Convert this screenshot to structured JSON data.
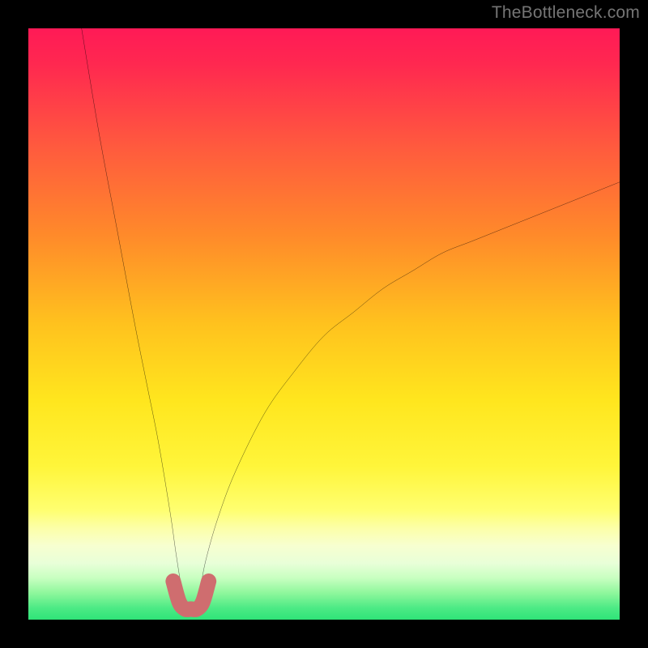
{
  "watermark": "TheBottleneck.com",
  "colors": {
    "black": "#000000",
    "curve": "#000000",
    "flat_region": "#cf6d6f",
    "bottom_green": "#2fe478"
  },
  "chart_data": {
    "type": "line",
    "title": "",
    "xlabel": "",
    "ylabel": "",
    "xlim": [
      0,
      100
    ],
    "ylim": [
      0,
      100
    ],
    "note": "V-shaped bottleneck curve on a vertical heat gradient. x normalized 0–100, y normalized 0–100 (0 = bottom/green, 100 = top/red). Minimum near x≈27. Left branch approaches y≈100 at x≈9; right branch rises to y≈74 at x=100.",
    "series": [
      {
        "name": "bottleneck-curve",
        "x": [
          9,
          12,
          15,
          18,
          20,
          22,
          24,
          25,
          26,
          27,
          28,
          29,
          30,
          32,
          35,
          40,
          45,
          50,
          55,
          60,
          65,
          70,
          75,
          80,
          85,
          90,
          95,
          100
        ],
        "y": [
          100,
          82,
          66,
          50,
          40,
          30,
          18,
          11,
          5,
          2,
          2,
          5,
          10,
          17,
          25,
          35,
          42,
          48,
          52,
          56,
          59,
          62,
          64,
          66,
          68,
          70,
          72,
          74
        ]
      },
      {
        "name": "flat-bottom-highlight",
        "x": [
          24.5,
          25.5,
          26.5,
          27.5,
          28.5,
          29.5,
          30.5
        ],
        "y": [
          6.5,
          3,
          1.8,
          1.8,
          1.8,
          3,
          6.5
        ]
      }
    ],
    "gradient_stops": [
      {
        "pos": 0.0,
        "color": "#ff1a56"
      },
      {
        "pos": 0.06,
        "color": "#ff2850"
      },
      {
        "pos": 0.2,
        "color": "#ff5a3e"
      },
      {
        "pos": 0.35,
        "color": "#ff8a2a"
      },
      {
        "pos": 0.5,
        "color": "#ffc21e"
      },
      {
        "pos": 0.63,
        "color": "#ffe61e"
      },
      {
        "pos": 0.74,
        "color": "#fff53a"
      },
      {
        "pos": 0.815,
        "color": "#ffff70"
      },
      {
        "pos": 0.845,
        "color": "#fcffa8"
      },
      {
        "pos": 0.875,
        "color": "#f7ffd0"
      },
      {
        "pos": 0.905,
        "color": "#e8ffd8"
      },
      {
        "pos": 0.93,
        "color": "#c7ffc0"
      },
      {
        "pos": 0.955,
        "color": "#8ef79c"
      },
      {
        "pos": 0.98,
        "color": "#4dea85"
      },
      {
        "pos": 1.0,
        "color": "#2fe478"
      }
    ]
  }
}
